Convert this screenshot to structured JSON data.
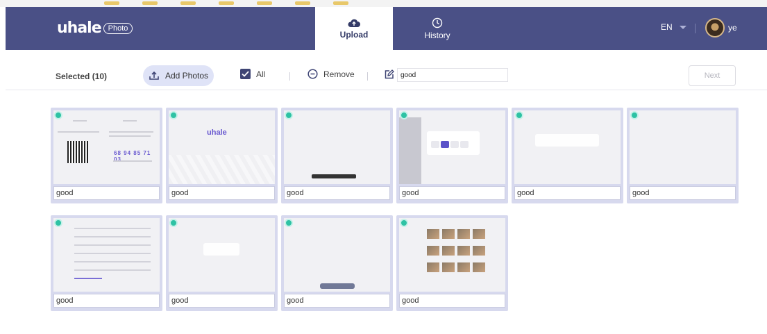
{
  "header": {
    "logo_word": "uhale",
    "logo_badge": "Photo",
    "tabs": [
      {
        "label": "Upload",
        "icon": "cloud-upload-icon",
        "active": true
      },
      {
        "label": "History",
        "icon": "clock-icon",
        "active": false
      }
    ],
    "language": "EN",
    "username": "ye"
  },
  "toolbar": {
    "selected_label": "Selected (10)",
    "add_photos_label": "Add Photos",
    "all_label": "All",
    "remove_label": "Remove",
    "tag_value": "good",
    "next_label": "Next"
  },
  "photos": [
    {
      "tag": "good",
      "kind": "doc",
      "code": "68 94 85 71 03"
    },
    {
      "tag": "good",
      "kind": "welcome",
      "logo": "uhale"
    },
    {
      "tag": "good",
      "kind": "form"
    },
    {
      "tag": "good",
      "kind": "settings"
    },
    {
      "tag": "good",
      "kind": "photo1"
    },
    {
      "tag": "good",
      "kind": "photo2"
    },
    {
      "tag": "good",
      "kind": "list"
    },
    {
      "tag": "good",
      "kind": "photo3"
    },
    {
      "tag": "good",
      "kind": "photo4"
    },
    {
      "tag": "good",
      "kind": "grid"
    }
  ],
  "colors": {
    "header_bg": "#4a5086",
    "accent": "#dfe3f7",
    "card_frame": "#d7d9ee",
    "select_dot": "#2ec2a4"
  }
}
